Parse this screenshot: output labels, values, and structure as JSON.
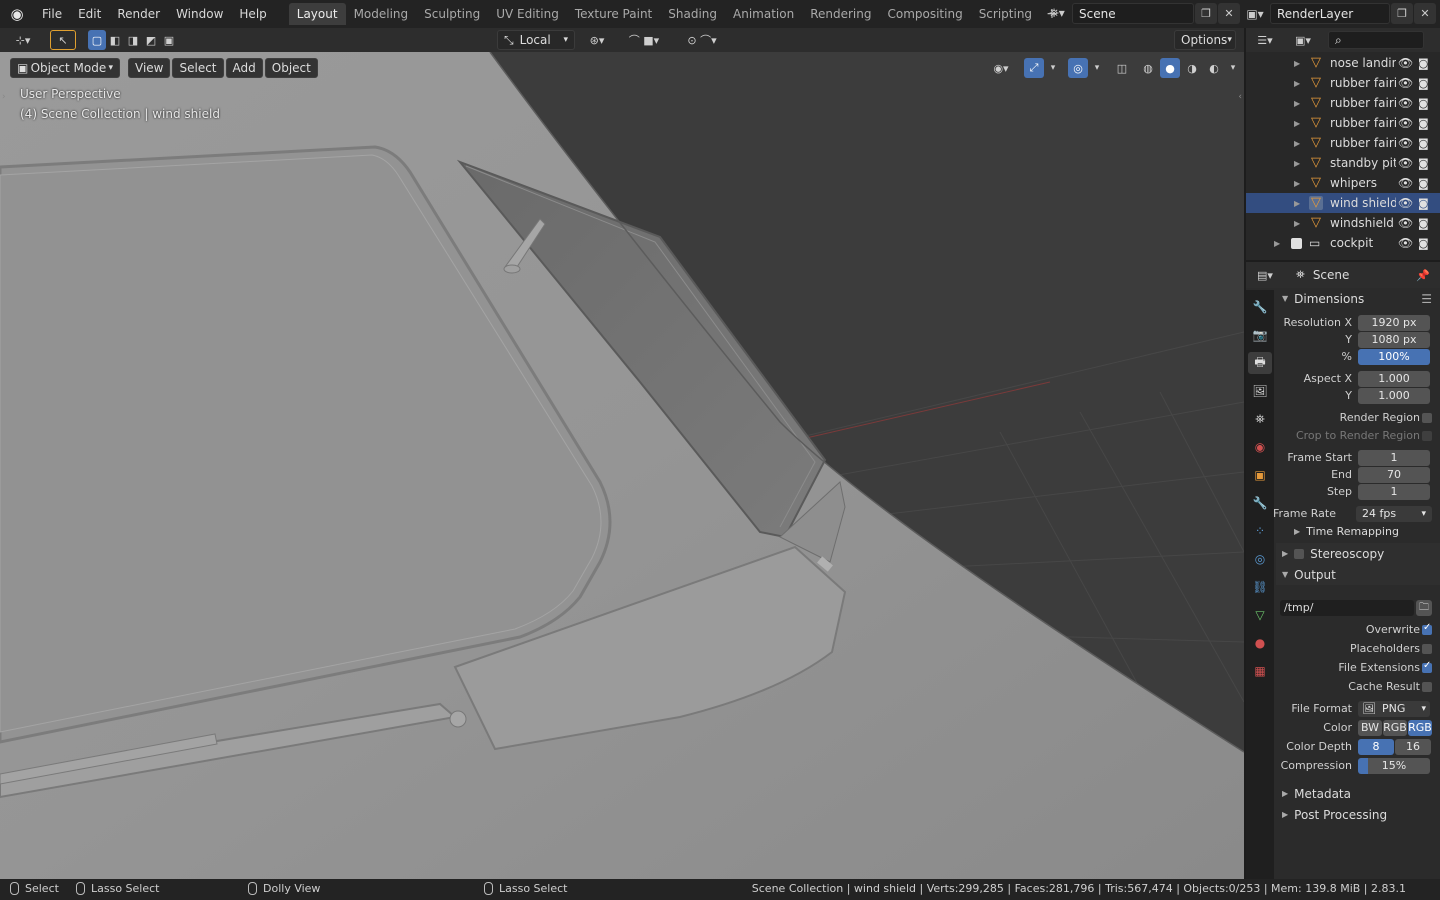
{
  "menu": [
    "File",
    "Edit",
    "Render",
    "Window",
    "Help"
  ],
  "workspaces": [
    "Layout",
    "Modeling",
    "Sculpting",
    "UV Editing",
    "Texture Paint",
    "Shading",
    "Animation",
    "Rendering",
    "Compositing",
    "Scripting"
  ],
  "active_workspace": "Layout",
  "scene_name": "Scene",
  "view_layer": "RenderLayer",
  "viewport": {
    "transform_orientation": "Local",
    "options_label": "Options",
    "mode": "Object Mode",
    "menus": [
      "View",
      "Select",
      "Add",
      "Object"
    ],
    "perspective_label": "User Perspective",
    "collection_label": "(4) Scene Collection | wind shield"
  },
  "outliner": {
    "items": [
      {
        "name": "nose landing",
        "selected": false
      },
      {
        "name": "rubber fairin",
        "selected": false
      },
      {
        "name": "rubber fairin",
        "selected": false
      },
      {
        "name": "rubber fairin",
        "selected": false
      },
      {
        "name": "rubber fairin",
        "selected": false
      },
      {
        "name": "standby pitit",
        "selected": false
      },
      {
        "name": "whipers",
        "selected": false
      },
      {
        "name": "wind shield",
        "selected": true
      },
      {
        "name": "windshield c",
        "selected": false
      }
    ],
    "collection": "cockpit"
  },
  "properties": {
    "context": "Scene",
    "dimensions": {
      "title": "Dimensions",
      "resolution_x_label": "Resolution X",
      "resolution_x": "1920 px",
      "resolution_y_label": "Y",
      "resolution_y": "1080 px",
      "percent_label": "%",
      "percent": "100%",
      "aspect_x_label": "Aspect X",
      "aspect_x": "1.000",
      "aspect_y_label": "Y",
      "aspect_y": "1.000",
      "render_region": "Render Region",
      "crop_region": "Crop to Render Region",
      "frame_start_label": "Frame Start",
      "frame_start": "1",
      "frame_end_label": "End",
      "frame_end": "70",
      "frame_step_label": "Step",
      "frame_step": "1",
      "frame_rate_label": "Frame Rate",
      "frame_rate": "24 fps",
      "time_remapping": "Time Remapping"
    },
    "stereoscopy": "Stereoscopy",
    "output": {
      "title": "Output",
      "path": "/tmp/",
      "overwrite": "Overwrite",
      "placeholders": "Placeholders",
      "file_extensions": "File Extensions",
      "cache_result": "Cache Result",
      "file_format_label": "File Format",
      "file_format": "PNG",
      "color_label": "Color",
      "color_options": [
        "BW",
        "RGB",
        "RGB"
      ],
      "color_depth_label": "Color Depth",
      "color_depth_options": [
        "8",
        "16"
      ],
      "compression_label": "Compression",
      "compression": "15%"
    },
    "metadata": "Metadata",
    "post_processing": "Post Processing"
  },
  "statusbar": {
    "select": "Select",
    "lasso_select": "Lasso Select",
    "dolly_view": "Dolly View",
    "lasso_select_2": "Lasso Select",
    "stats": "Scene Collection | wind shield | Verts:299,285 | Faces:281,796 | Tris:567,474 | Objects:0/253 | Mem: 139.8 MiB | 2.83.1"
  },
  "colors": {
    "accent": "#4772b3",
    "object_icon": "#e59a3b",
    "selection_row": "#334d80"
  }
}
